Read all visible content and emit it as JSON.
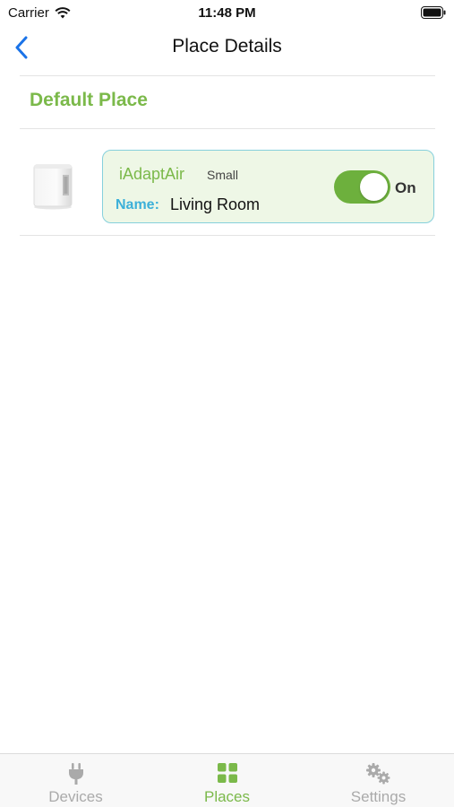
{
  "status_bar": {
    "carrier": "Carrier",
    "time": "11:48 PM"
  },
  "nav": {
    "title": "Place Details",
    "back_icon": "chevron-left-icon"
  },
  "place": {
    "name": "Default Place"
  },
  "device": {
    "model": "iAdaptAir",
    "size": "Small",
    "name_label": "Name:",
    "name_value": "Living Room",
    "power_state": "On",
    "power_on": true
  },
  "tabs": [
    {
      "label": "Devices",
      "icon": "plug-icon",
      "active": false
    },
    {
      "label": "Places",
      "icon": "grid-icon",
      "active": true
    },
    {
      "label": "Settings",
      "icon": "gears-icon",
      "active": false
    }
  ],
  "colors": {
    "accent_green": "#7bb94a",
    "toggle_green": "#6db03d",
    "name_blue": "#3cb0d9",
    "card_bg": "#eef7e6",
    "card_border": "#86d0dc",
    "ios_blue": "#1a73e8"
  }
}
